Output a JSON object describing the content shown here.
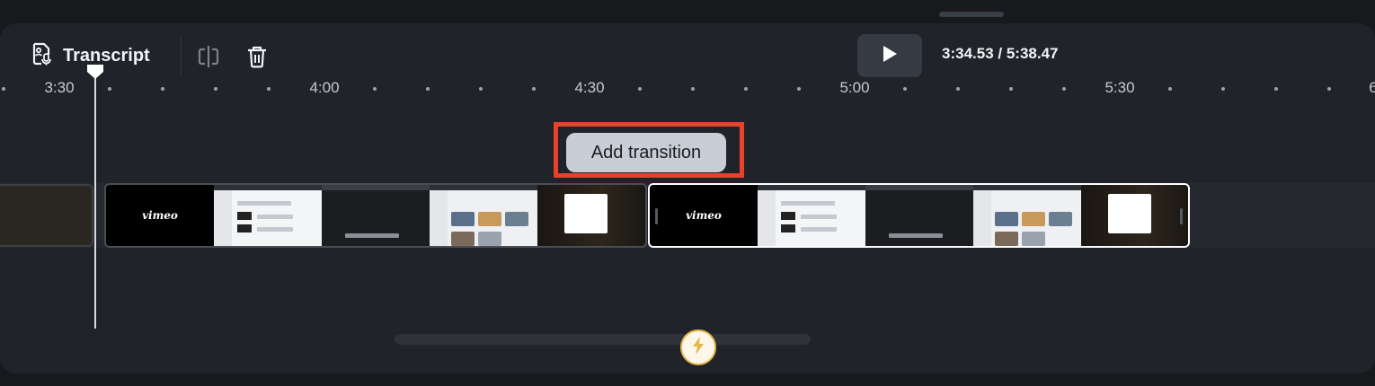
{
  "toolbar": {
    "transcript_label": "Transcript",
    "timecode_current": "3:34.53",
    "timecode_separator": " / ",
    "timecode_total": "5:38.47"
  },
  "ruler": {
    "labels": [
      "3:30",
      "4:00",
      "4:30",
      "5:00",
      "5:30",
      "6"
    ]
  },
  "add_transition_label": "Add transition",
  "clips": [
    {
      "brand": "vimeo"
    },
    {
      "brand": "vimeo"
    }
  ],
  "colors": {
    "highlight": "#e8412c",
    "background": "#17191d",
    "panel": "#202329",
    "bolt": "#e3b64a"
  }
}
